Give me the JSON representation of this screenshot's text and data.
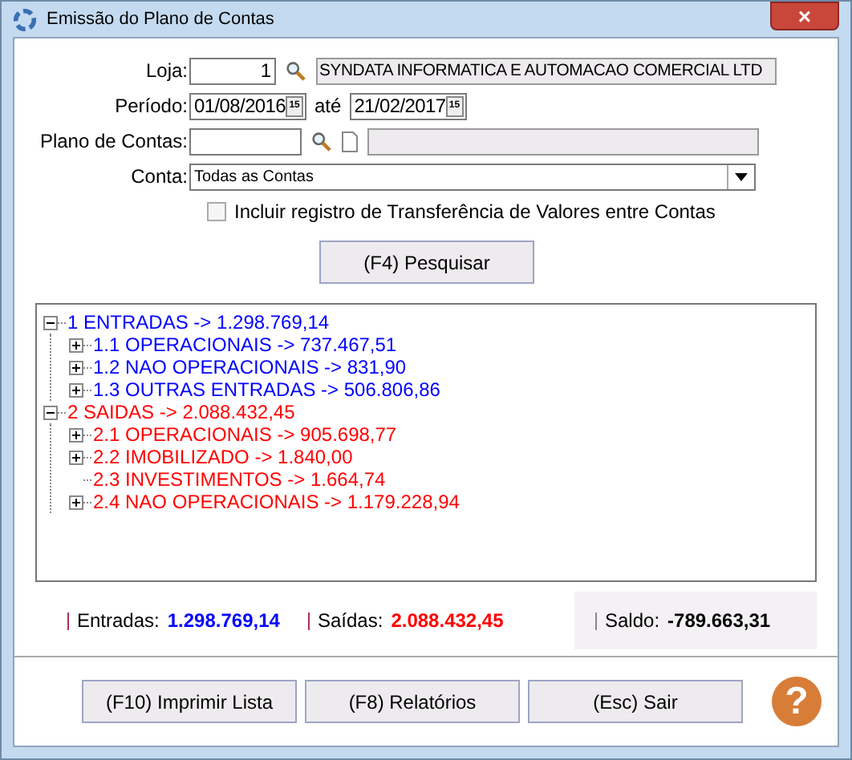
{
  "window": {
    "title": "Emissão do Plano de Contas",
    "close": "×"
  },
  "form": {
    "loja_label": "Loja:",
    "loja_value": "1",
    "company": "SYNDATA INFORMATICA E AUTOMACAO COMERCIAL LTD",
    "periodo_label": "Período:",
    "date_from": "01/08/2016",
    "ate_label": "até",
    "date_to": "21/02/2017",
    "calendar_from": "15",
    "calendar_to": "15",
    "plano_label": "Plano de Contas:",
    "conta_label": "Conta:",
    "conta_value": "Todas as Contas",
    "transfer_checkbox": {
      "label": "Incluir registro de Transferência de Valores entre Contas",
      "checked": false
    }
  },
  "search_button": "(F4) Pesquisar",
  "tree": [
    {
      "text": "1 ENTRADAS -> 1.298.769,14",
      "color": "#0000ff",
      "expanded": true,
      "children": [
        {
          "text": "1.1 OPERACIONAIS -> 737.467,51",
          "color": "#0000ff",
          "kind": "folder",
          "expanded": false
        },
        {
          "text": "1.2 NAO OPERACIONAIS -> 831,90",
          "color": "#0000ff",
          "kind": "folder",
          "expanded": false
        },
        {
          "text": "1.3 OUTRAS ENTRADAS -> 506.806,86",
          "color": "#0000ff",
          "kind": "folder",
          "expanded": false
        }
      ]
    },
    {
      "text": "2 SAIDAS -> 2.088.432,45",
      "color": "#ff0000",
      "expanded": true,
      "children": [
        {
          "text": "2.1 OPERACIONAIS -> 905.698,77",
          "color": "#ff0000",
          "kind": "folder",
          "expanded": false
        },
        {
          "text": "2.2 IMOBILIZADO -> 1.840,00",
          "color": "#ff0000",
          "kind": "folder",
          "expanded": false
        },
        {
          "text": "2.3 INVESTIMENTOS -> 1.664,74",
          "color": "#ff0000",
          "kind": "leaf"
        },
        {
          "text": "2.4 NAO OPERACIONAIS -> 1.179.228,94",
          "color": "#ff0000",
          "kind": "folder",
          "expanded": false
        }
      ]
    }
  ],
  "summary": [
    {
      "label": "Entradas:",
      "value": "1.298.769,14",
      "color": "#0000ff",
      "kind": "plain"
    },
    {
      "label": "Saídas:",
      "value": "2.088.432,45",
      "color": "#ff0000",
      "kind": "plain"
    },
    {
      "label": "Saldo:",
      "value": "-789.663,31",
      "color": "#000000",
      "kind": "panel"
    }
  ],
  "buttons": [
    "(F10) Imprimir Lista",
    "(F8) Relatórios",
    "(Esc) Sair"
  ],
  "help": "?"
}
